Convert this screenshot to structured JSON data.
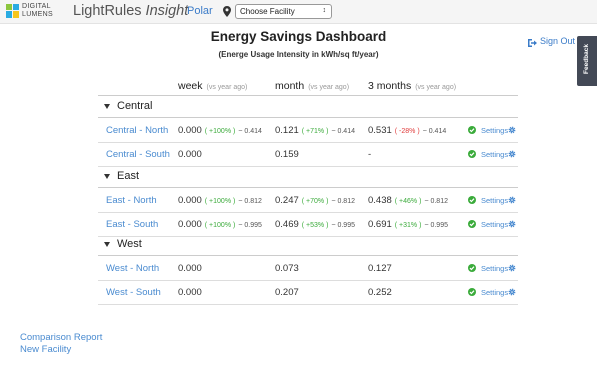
{
  "topbar": {
    "logo_line1": "DIGITAL",
    "logo_line2": "LUMENS",
    "brand_name": "LightRules",
    "brand_suffix": "Insight",
    "site": "Polar",
    "facility_select": "Choose Facility",
    "select_arrows": "↕"
  },
  "header": {
    "title": "Energy Savings Dashboard",
    "subtitle": "(Energe Usage Intensity in kWh/sq ft/year)",
    "sign_out": "Sign Out",
    "feedback": "Feedback"
  },
  "columns": [
    {
      "label": "week",
      "vs": "(vs year ago)"
    },
    {
      "label": "month",
      "vs": "(vs year ago)"
    },
    {
      "label": "3 months",
      "vs": "(vs year ago)"
    }
  ],
  "groups": [
    {
      "name": "Central",
      "rows": [
        {
          "name": "Central - North",
          "cells": [
            {
              "value": "0.000",
              "pct": "( +100% )",
              "pct_sign": "pos",
              "prev": "~ 0.414"
            },
            {
              "value": "0.121",
              "pct": "( +71% )",
              "pct_sign": "pos",
              "prev": "~ 0.414"
            },
            {
              "value": "0.531",
              "pct": "( -28% )",
              "pct_sign": "neg",
              "prev": "~ 0.414"
            }
          ]
        },
        {
          "name": "Central - South",
          "cells": [
            {
              "value": "0.000",
              "pct": "",
              "pct_sign": "",
              "prev": ""
            },
            {
              "value": "0.159",
              "pct": "",
              "pct_sign": "",
              "prev": ""
            },
            {
              "value": "-",
              "pct": "",
              "pct_sign": "",
              "prev": ""
            }
          ]
        }
      ]
    },
    {
      "name": "East",
      "rows": [
        {
          "name": "East - North",
          "cells": [
            {
              "value": "0.000",
              "pct": "( +100% )",
              "pct_sign": "pos",
              "prev": "~ 0.812"
            },
            {
              "value": "0.247",
              "pct": "( +70% )",
              "pct_sign": "pos",
              "prev": "~ 0.812"
            },
            {
              "value": "0.438",
              "pct": "( +46% )",
              "pct_sign": "pos",
              "prev": "~ 0.812"
            }
          ]
        },
        {
          "name": "East - South",
          "cells": [
            {
              "value": "0.000",
              "pct": "( +100% )",
              "pct_sign": "pos",
              "prev": "~ 0.995"
            },
            {
              "value": "0.469",
              "pct": "( +53% )",
              "pct_sign": "pos",
              "prev": "~ 0.995"
            },
            {
              "value": "0.691",
              "pct": "( +31% )",
              "pct_sign": "pos",
              "prev": "~ 0.995"
            }
          ]
        }
      ]
    },
    {
      "name": "West",
      "rows": [
        {
          "name": "West - North",
          "cells": [
            {
              "value": "0.000",
              "pct": "",
              "pct_sign": "",
              "prev": ""
            },
            {
              "value": "0.073",
              "pct": "",
              "pct_sign": "",
              "prev": ""
            },
            {
              "value": "0.127",
              "pct": "",
              "pct_sign": "",
              "prev": ""
            }
          ]
        },
        {
          "name": "West - South",
          "cells": [
            {
              "value": "0.000",
              "pct": "",
              "pct_sign": "",
              "prev": ""
            },
            {
              "value": "0.207",
              "pct": "",
              "pct_sign": "",
              "prev": ""
            },
            {
              "value": "0.252",
              "pct": "",
              "pct_sign": "",
              "prev": ""
            }
          ]
        }
      ]
    }
  ],
  "settings_label": "Settings",
  "footer": {
    "comparison_report": "Comparison Report",
    "new_facility": "New Facility"
  },
  "colors": {
    "link": "#4a8bd0",
    "positive": "#3bab3b",
    "negative": "#e03b3b",
    "check": "#3bab3b",
    "feedback_tab": "#434956"
  },
  "icons": [
    "logo-mark",
    "map-pin-icon",
    "sign-out-icon",
    "check-circle-icon",
    "gear-icon",
    "caret-down-icon"
  ]
}
